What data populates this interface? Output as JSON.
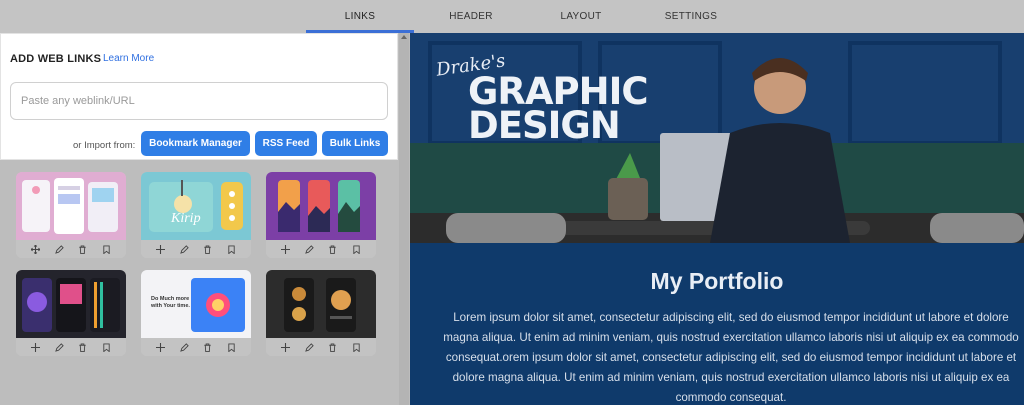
{
  "tabs": [
    {
      "label": "LINKS",
      "active": true
    },
    {
      "label": "HEADER",
      "active": false
    },
    {
      "label": "LAYOUT",
      "active": false
    },
    {
      "label": "SETTINGS",
      "active": false
    }
  ],
  "links_panel": {
    "title": "ADD WEB LINKS",
    "learn_more": "Learn More",
    "input_placeholder": "Paste any weblink/URL",
    "import_label": "or Import from:",
    "buttons": [
      "Bookmark Manager",
      "RSS Feed",
      "Bulk Links"
    ]
  },
  "templates": {
    "tile_tools": [
      "move-icon",
      "edit-icon",
      "trash-icon",
      "bookmark-icon"
    ],
    "row2_tile2_text": "Do Much more with Your time."
  },
  "preview": {
    "hero_script": "Drake's",
    "hero_title_line1": "GRAPHIC",
    "hero_title_line2": "DESIGN",
    "heading": "My Portfolio",
    "body": "Lorem ipsum dolor sit amet, consectetur adipiscing elit, sed do eiusmod tempor incididunt ut labore et dolore magna aliqua. Ut enim ad minim veniam, quis nostrud exercitation ullamco laboris nisi ut aliquip ex ea commodo consequat.orem ipsum dolor sit amet, consectetur adipiscing elit, sed do eiusmod tempor incididunt ut labore et dolore magna aliqua. Ut enim ad minim veniam, quis nostrud exercitation ullamco laboris nisi ut aliquip ex ea commodo consequat."
  },
  "colors": {
    "accent": "#2f7ee6",
    "tab_underline": "#3b6fd6",
    "preview_bg": "#0f3a6b"
  }
}
